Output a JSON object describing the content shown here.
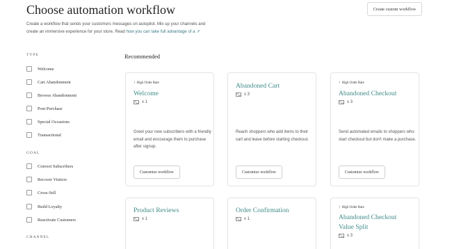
{
  "header": {
    "title": "Choose automation workflow",
    "create_button": "Create custom workflow",
    "intro_line1": "Create a workflow that sends your customers messages on autopilot. Mix up your channels and",
    "intro_line2": "create an immersive experience for your store. Read ",
    "intro_link": "how you can take full advantage of a",
    "external_icon": "external-link-icon"
  },
  "filters": {
    "type_heading": "TYPE",
    "type_items": [
      "Welcome",
      "Cart Abandonment",
      "Browse Abandonment",
      "Post-Purchase",
      "Special Occasions",
      "Transactional"
    ],
    "goal_heading": "GOAL",
    "goal_items": [
      "Convert Subscribers",
      "Recover Visitors",
      "Cross-Sell",
      "Build Loyalty",
      "Reactivate Customers"
    ],
    "channel_heading": "CHANNEL"
  },
  "recommended": {
    "title": "Recommended",
    "cards": [
      {
        "badge": "High Order Rate",
        "title": "Welcome",
        "channel_count": "x 1",
        "description": "Greet your new subscribers with a friendly email and encourage them to purchase after signup.",
        "button": "Customize workflow"
      },
      {
        "badge": "",
        "title": "Abandoned Cart",
        "channel_count": "x 3",
        "description": "Reach shoppers who add items to their cart and leave before starting checkout.",
        "button": "Customize workflow"
      },
      {
        "badge": "High Order Rate",
        "title": "Abandoned Checkout",
        "channel_count": "x 3",
        "description": "Send automated emails to shoppers who start checkout but don't make a purchase.",
        "button": "Customize workflow"
      },
      {
        "badge": "",
        "title": "Product Reviews",
        "channel_count": "x 1"
      },
      {
        "badge": "",
        "title": "Order Confirmation",
        "channel_count": "x 1"
      },
      {
        "badge": "High Order Rate",
        "title": "Abandoned Checkout Value Split",
        "channel_count": "x 3"
      }
    ]
  },
  "icons": {
    "badge": "arrow-up-icon",
    "channel": "mail-icon"
  },
  "colors": {
    "accent": "#3f8a89",
    "link": "#3f7c86",
    "border": "#e4e4e4"
  }
}
